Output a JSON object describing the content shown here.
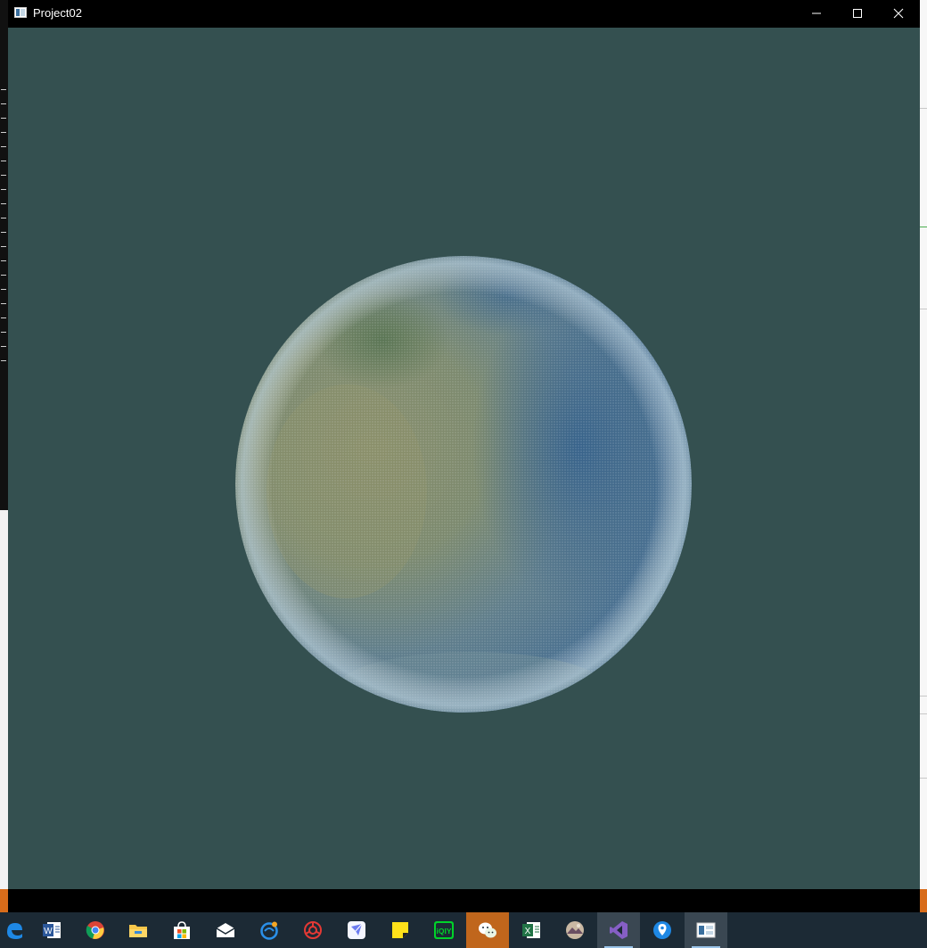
{
  "window": {
    "title": "Project02",
    "buttons": {
      "minimize": "minimize",
      "maximize": "maximize",
      "close": "close"
    }
  },
  "scene": {
    "background_color": "#345050",
    "object": "point-cloud sphere",
    "colors": {
      "yellow_tint": "#a7a76f",
      "green_tint": "#6f8a5e",
      "blue_tint": "#3b6a9e",
      "rim_tint": "#b8d3e0"
    }
  },
  "taskbar": {
    "items": [
      {
        "name": "edge-icon",
        "label": "Microsoft Edge",
        "state": "pinned"
      },
      {
        "name": "word-icon",
        "label": "Word",
        "state": "pinned"
      },
      {
        "name": "chrome-icon",
        "label": "Google Chrome",
        "state": "pinned"
      },
      {
        "name": "file-explorer-icon",
        "label": "File Explorer",
        "state": "pinned"
      },
      {
        "name": "store-icon",
        "label": "Microsoft Store",
        "state": "pinned"
      },
      {
        "name": "mail-icon",
        "label": "Mail",
        "state": "pinned"
      },
      {
        "name": "browser-blue-icon",
        "label": "Browser",
        "state": "pinned"
      },
      {
        "name": "security-red-icon",
        "label": "Security",
        "state": "pinned"
      },
      {
        "name": "feishu-icon",
        "label": "Messenger",
        "state": "pinned"
      },
      {
        "name": "sticky-notes-icon",
        "label": "Sticky Notes",
        "state": "pinned"
      },
      {
        "name": "iqiyi-icon",
        "label": "iQIYI",
        "state": "pinned"
      },
      {
        "name": "wechat-icon",
        "label": "WeChat",
        "state": "active"
      },
      {
        "name": "excel-icon",
        "label": "Excel",
        "state": "pinned"
      },
      {
        "name": "photo-app-icon",
        "label": "Photos",
        "state": "pinned"
      },
      {
        "name": "visual-studio-icon",
        "label": "Visual Studio",
        "state": "open"
      },
      {
        "name": "maps-icon",
        "label": "Maps",
        "state": "pinned"
      },
      {
        "name": "project02-window-icon",
        "label": "Project02",
        "state": "open"
      }
    ]
  }
}
